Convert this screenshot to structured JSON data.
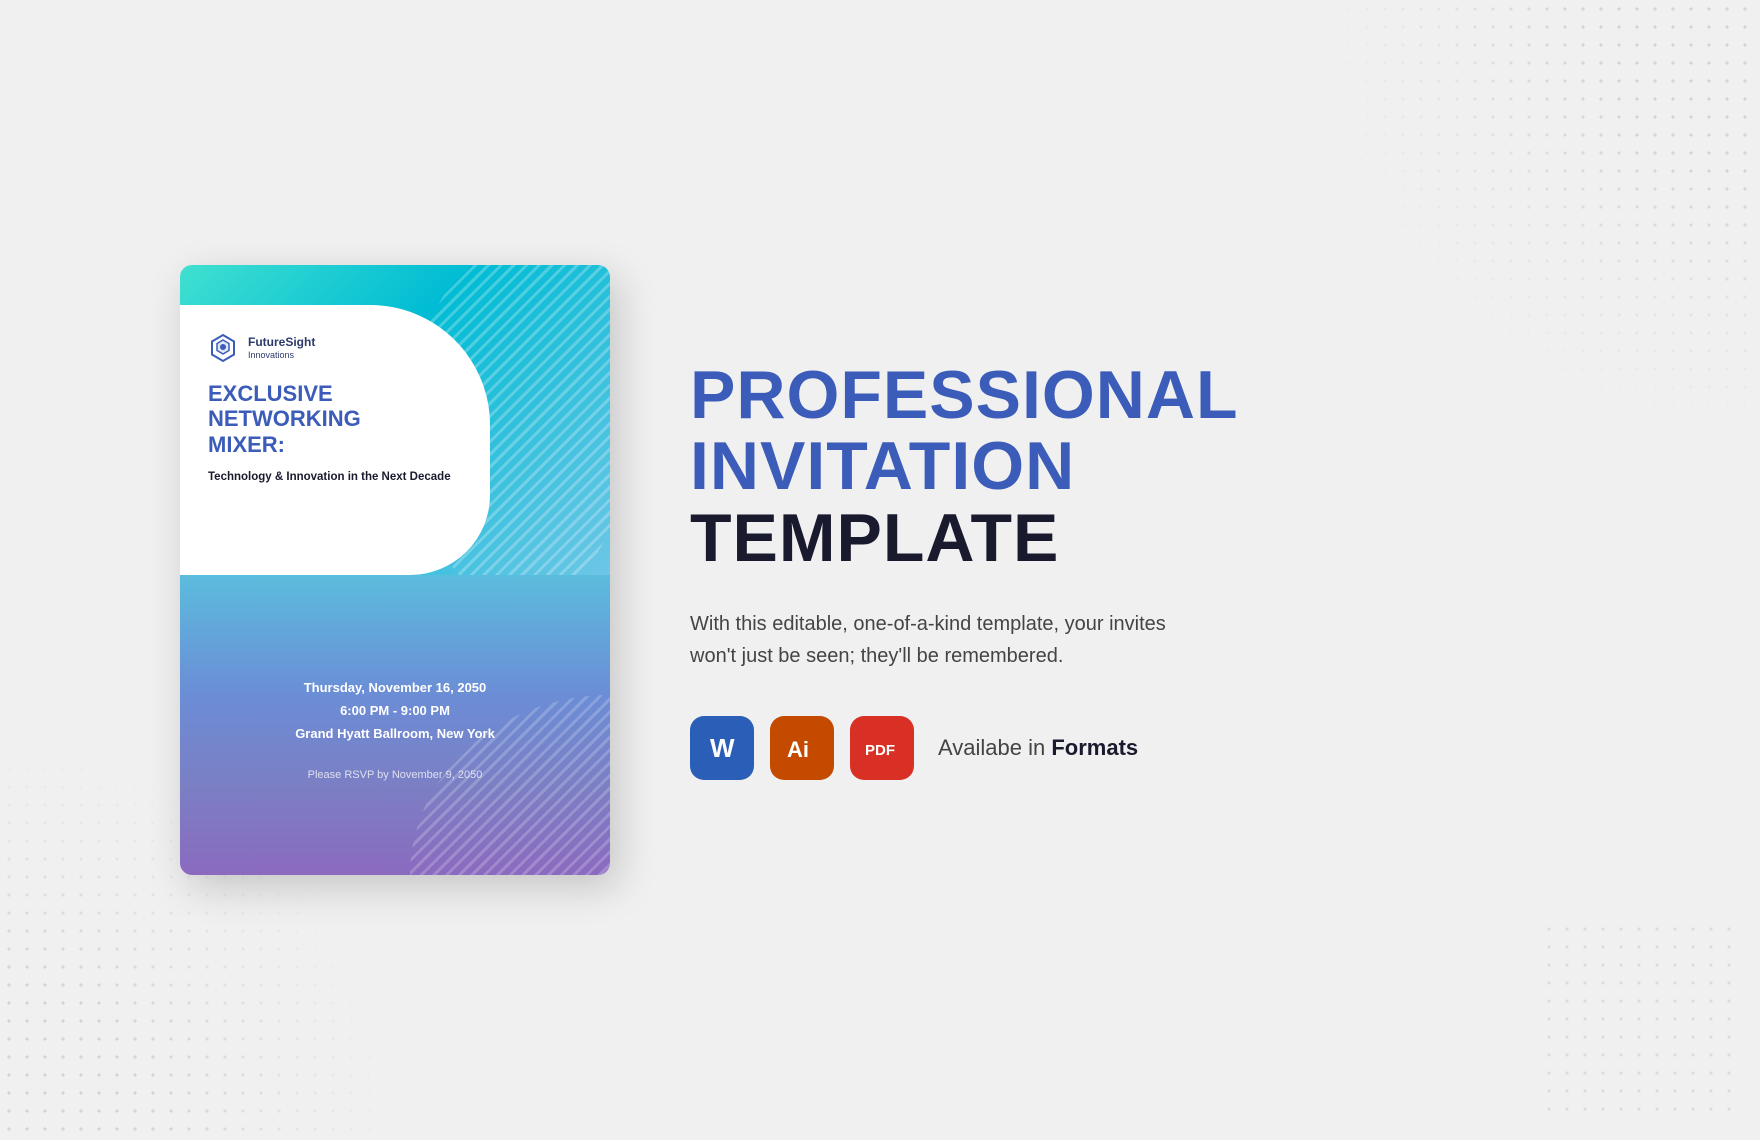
{
  "background": {
    "color": "#f0f0f0"
  },
  "card": {
    "logo": {
      "name": "FutureSight",
      "subtitle": "Innovations"
    },
    "event_title": "EXCLUSIVE\nNETWORKING\nMIXER:",
    "event_subtitle": "Technology & Innovation in the\nNext Decade",
    "date": "Thursday, November 16, 2050",
    "time": "6:00 PM - 9:00 PM",
    "venue": "Grand Hyatt Ballroom, New York",
    "rsvp": "Please RSVP by November 9, 2050"
  },
  "right": {
    "title_line1": "PROFESSIONAL",
    "title_line2": "INVITATION",
    "title_line3": "TEMPLATE",
    "description": "With this editable, one-of-a-kind template, your invites won't just be seen; they'll be remembered.",
    "formats_label_plain": "Availabe in ",
    "formats_label_bold": "Formats",
    "format_icons": [
      {
        "label": "W",
        "type": "word",
        "title": "Microsoft Word"
      },
      {
        "label": "Ai",
        "type": "ai",
        "title": "Adobe Illustrator"
      },
      {
        "label": "PDF",
        "type": "pdf",
        "title": "Adobe PDF"
      }
    ]
  }
}
